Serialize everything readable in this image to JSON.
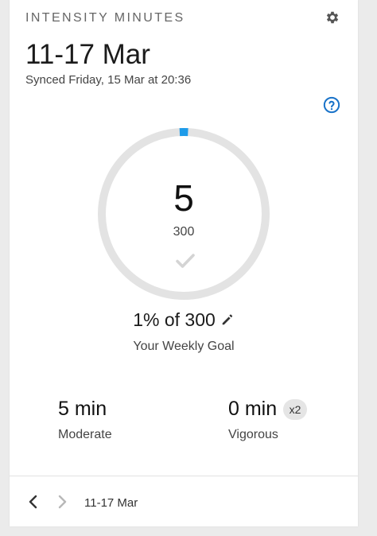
{
  "widget": {
    "title": "INTENSITY MINUTES",
    "date_range": "11-17 Mar",
    "synced": "Synced Friday, 15 Mar at 20:36"
  },
  "ring": {
    "value": "5",
    "goal": "300",
    "progress_fraction": 0.0167,
    "track_color": "#e3e3e3",
    "progress_color": "#1e9be9"
  },
  "goal": {
    "percent_text": "1% of 300",
    "caption": "Your Weekly Goal"
  },
  "stats": {
    "moderate_value": "5 min",
    "moderate_label": "Moderate",
    "vigorous_value": "0 min",
    "vigorous_label": "Vigorous",
    "vigorous_multiplier": "x2"
  },
  "footer": {
    "range_label": "11-17 Mar"
  },
  "icons": {
    "settings": "gear-icon",
    "help": "question-circle-icon",
    "check": "check-icon",
    "edit": "pencil-icon",
    "prev": "chevron-left-icon",
    "next": "chevron-right-icon"
  },
  "colors": {
    "accent": "#1a73c9"
  }
}
